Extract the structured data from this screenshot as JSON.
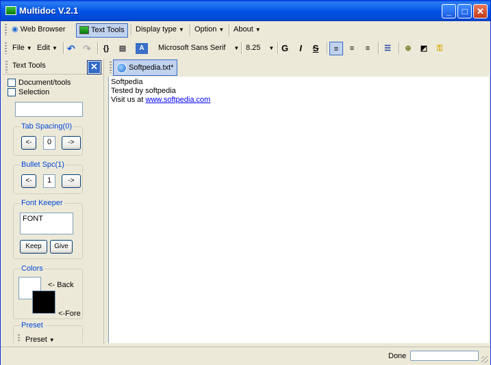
{
  "window": {
    "title": "Multidoc V.2.1"
  },
  "menubar": {
    "web_browser": "Web Browser",
    "text_tools": "Text Tools",
    "display_type": "Display type",
    "option": "Option",
    "about": "About"
  },
  "toolbar": {
    "file": "File",
    "edit": "Edit",
    "font_name": "Microsoft Sans Serif",
    "font_size": "8.25",
    "bold_glyph": "G",
    "italic_glyph": "I",
    "strike_glyph": "S",
    "braces_glyph": "{}"
  },
  "left_panel": {
    "title": "Text Tools",
    "document_tools": "Document/tools",
    "selection": "Selection",
    "tab_spacing_title": "Tab Spacing(0)",
    "tab_spacing_value": "0",
    "bullet_spc_title": "Bullet Spc(1)",
    "bullet_spc_value": "1",
    "dec_label": "<-",
    "inc_label": "->",
    "font_keeper_title": "Font Keeper",
    "font_keeper_value": "FONT",
    "keep_label": "Keep",
    "give_label": "Give",
    "colors_title": "Colors",
    "back_label": "<- Back",
    "fore_label": "<-Fore",
    "back_color": "#FFFFFF",
    "fore_color": "#000000",
    "preset_title": "Preset",
    "preset_button": "Preset"
  },
  "document": {
    "tab_label": "Softpedia.txt*",
    "lines": [
      "Softpedia",
      "Tested by softpedia"
    ],
    "visit_prefix": "Visit us at ",
    "visit_link": "www.softpedia.com"
  },
  "statusbar": {
    "status": "Done"
  }
}
